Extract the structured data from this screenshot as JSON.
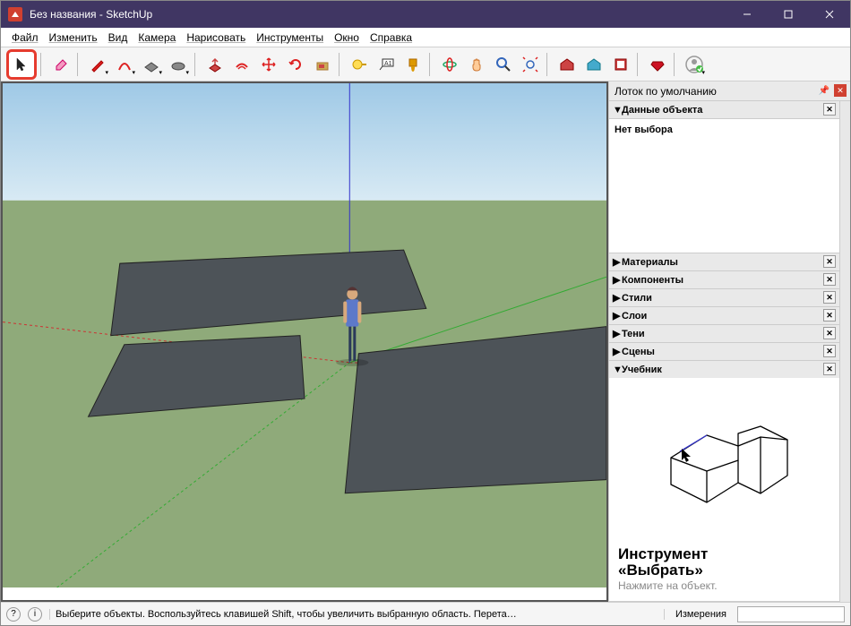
{
  "window": {
    "title": "Без названия - SketchUp"
  },
  "menu": {
    "items": [
      "Файл",
      "Изменить",
      "Вид",
      "Камера",
      "Нарисовать",
      "Инструменты",
      "Окно",
      "Справка"
    ]
  },
  "toolbar": {
    "tools": [
      {
        "name": "select-tool",
        "icon": "cursor",
        "highlighted": true
      },
      {
        "name": "eraser-tool",
        "icon": "eraser"
      },
      {
        "name": "line-tool",
        "icon": "pencil",
        "dd": true
      },
      {
        "name": "arc-tool",
        "icon": "arc",
        "dd": true
      },
      {
        "name": "rectangle-tool",
        "icon": "rect",
        "dd": true
      },
      {
        "name": "circle-tool",
        "icon": "circle",
        "dd": true
      },
      {
        "name": "pushpull-tool",
        "icon": "pushpull"
      },
      {
        "name": "offset-tool",
        "icon": "offset"
      },
      {
        "name": "move-tool",
        "icon": "move"
      },
      {
        "name": "rotate-tool",
        "icon": "rotate"
      },
      {
        "name": "scale-tool",
        "icon": "scale"
      },
      {
        "name": "tape-tool",
        "icon": "tape"
      },
      {
        "name": "text-tool",
        "icon": "text"
      },
      {
        "name": "paint-tool",
        "icon": "paint"
      },
      {
        "name": "orbit-tool",
        "icon": "orbit"
      },
      {
        "name": "pan-tool",
        "icon": "pan"
      },
      {
        "name": "zoom-tool",
        "icon": "zoom"
      },
      {
        "name": "zoom-extents-tool",
        "icon": "zoomext"
      },
      {
        "name": "warehouse-tool",
        "icon": "wh1"
      },
      {
        "name": "warehouse2-tool",
        "icon": "wh2"
      },
      {
        "name": "layout-tool",
        "icon": "layout"
      },
      {
        "name": "extensions-tool",
        "icon": "ruby"
      },
      {
        "name": "user-tool",
        "icon": "user",
        "dd": true
      }
    ]
  },
  "tray": {
    "title": "Лоток по умолчанию",
    "entity_info": {
      "label": "Данные объекта",
      "body": "Нет выбора"
    },
    "collapsed": [
      {
        "label": "Материалы"
      },
      {
        "label": "Компоненты"
      },
      {
        "label": "Стили"
      },
      {
        "label": "Слои"
      },
      {
        "label": "Тени"
      },
      {
        "label": "Сцены"
      }
    ],
    "tutorial": {
      "label": "Учебник",
      "title_line1": "Инструмент",
      "title_line2": "«Выбрать»",
      "hint": "Нажмите на объект."
    }
  },
  "status": {
    "text": "Выберите объекты. Воспользуйтесь клавишей Shift, чтобы увеличить выбранную область. Перета…",
    "measurements_label": "Измерения"
  }
}
